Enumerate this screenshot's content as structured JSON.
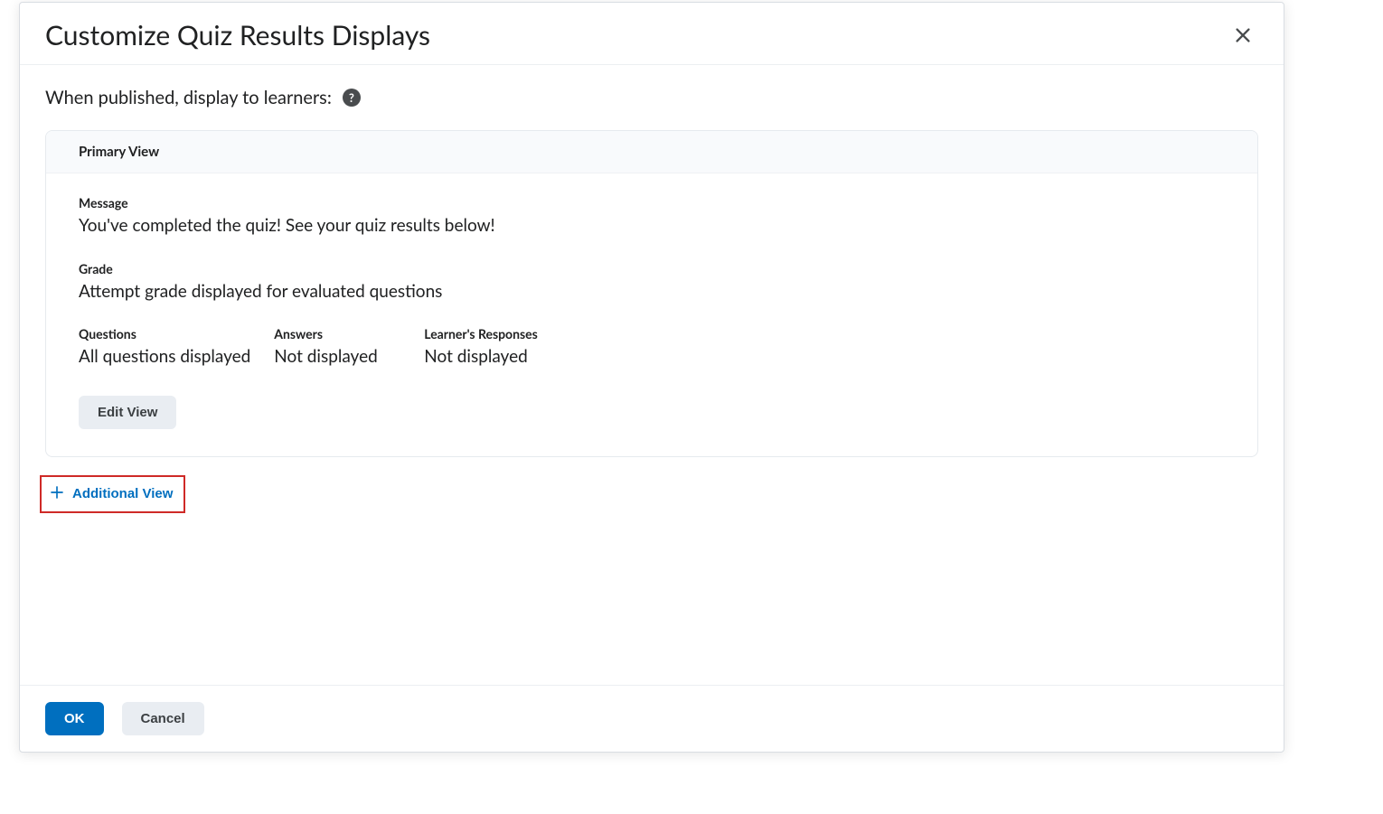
{
  "dialog": {
    "title": "Customize Quiz Results Displays",
    "close_tooltip": "Close",
    "subhead": "When published, display to learners:",
    "help_tooltip": "Help"
  },
  "primary_view": {
    "header": "Primary View",
    "message_label": "Message",
    "message_value": "You've completed the quiz! See your quiz results below!",
    "grade_label": "Grade",
    "grade_value": "Attempt grade displayed for evaluated questions",
    "questions_label": "Questions",
    "questions_value": "All questions displayed",
    "answers_label": "Answers",
    "answers_value": "Not displayed",
    "responses_label": "Learner's Responses",
    "responses_value": "Not displayed",
    "edit_button": "Edit View"
  },
  "add_view": {
    "label": "Additional View"
  },
  "footer": {
    "ok": "OK",
    "cancel": "Cancel"
  }
}
